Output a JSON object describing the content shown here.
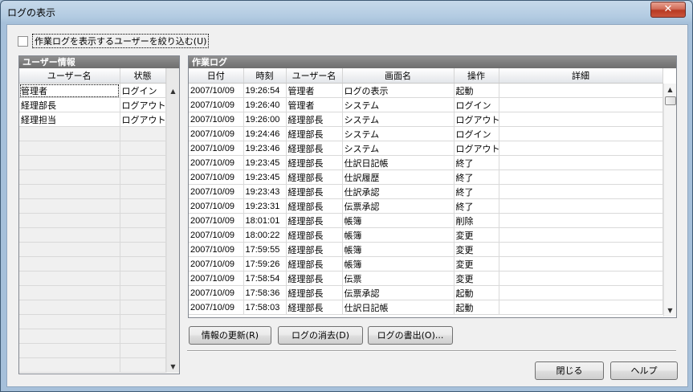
{
  "window": {
    "title": "ログの表示",
    "close_label": "✕"
  },
  "filter": {
    "label": "作業ログを表示するユーザーを絞り込む(U)",
    "checked": false
  },
  "users": {
    "header": "ユーザー情報",
    "columns": [
      "ユーザー名",
      "状態"
    ],
    "rows": [
      [
        "管理者",
        "ログイン"
      ],
      [
        "経理部長",
        "ログアウト"
      ],
      [
        "経理担当",
        "ログアウト"
      ]
    ]
  },
  "log": {
    "header": "作業ログ",
    "columns": [
      "日付",
      "時刻",
      "ユーザー名",
      "画面名",
      "操作",
      "詳細"
    ],
    "rows": [
      [
        "2007/10/09",
        "19:26:54",
        "管理者",
        "ログの表示",
        "起動",
        ""
      ],
      [
        "2007/10/09",
        "19:26:40",
        "管理者",
        "システム",
        "ログイン",
        ""
      ],
      [
        "2007/10/09",
        "19:26:00",
        "経理部長",
        "システム",
        "ログアウト",
        ""
      ],
      [
        "2007/10/09",
        "19:24:46",
        "経理部長",
        "システム",
        "ログイン",
        ""
      ],
      [
        "2007/10/09",
        "19:23:46",
        "経理部長",
        "システム",
        "ログアウト",
        ""
      ],
      [
        "2007/10/09",
        "19:23:45",
        "経理部長",
        "仕訳日記帳",
        "終了",
        ""
      ],
      [
        "2007/10/09",
        "19:23:45",
        "経理部長",
        "仕訳履歴",
        "終了",
        ""
      ],
      [
        "2007/10/09",
        "19:23:43",
        "経理部長",
        "仕訳承認",
        "終了",
        ""
      ],
      [
        "2007/10/09",
        "19:23:31",
        "経理部長",
        "伝票承認",
        "終了",
        ""
      ],
      [
        "2007/10/09",
        "18:01:01",
        "経理部長",
        "帳簿",
        "削除",
        ""
      ],
      [
        "2007/10/09",
        "18:00:22",
        "経理部長",
        "帳簿",
        "変更",
        ""
      ],
      [
        "2007/10/09",
        "17:59:55",
        "経理部長",
        "帳簿",
        "変更",
        ""
      ],
      [
        "2007/10/09",
        "17:59:26",
        "経理部長",
        "帳簿",
        "変更",
        ""
      ],
      [
        "2007/10/09",
        "17:58:54",
        "経理部長",
        "伝票",
        "変更",
        ""
      ],
      [
        "2007/10/09",
        "17:58:36",
        "経理部長",
        "伝票承認",
        "起動",
        ""
      ],
      [
        "2007/10/09",
        "17:58:03",
        "経理部長",
        "仕訳日記帳",
        "起動",
        ""
      ]
    ]
  },
  "buttons": {
    "refresh": "情報の更新(R)",
    "clear": "ログの消去(D)",
    "export": "ログの書出(O)...",
    "close": "閉じる",
    "help": "ヘルプ"
  }
}
